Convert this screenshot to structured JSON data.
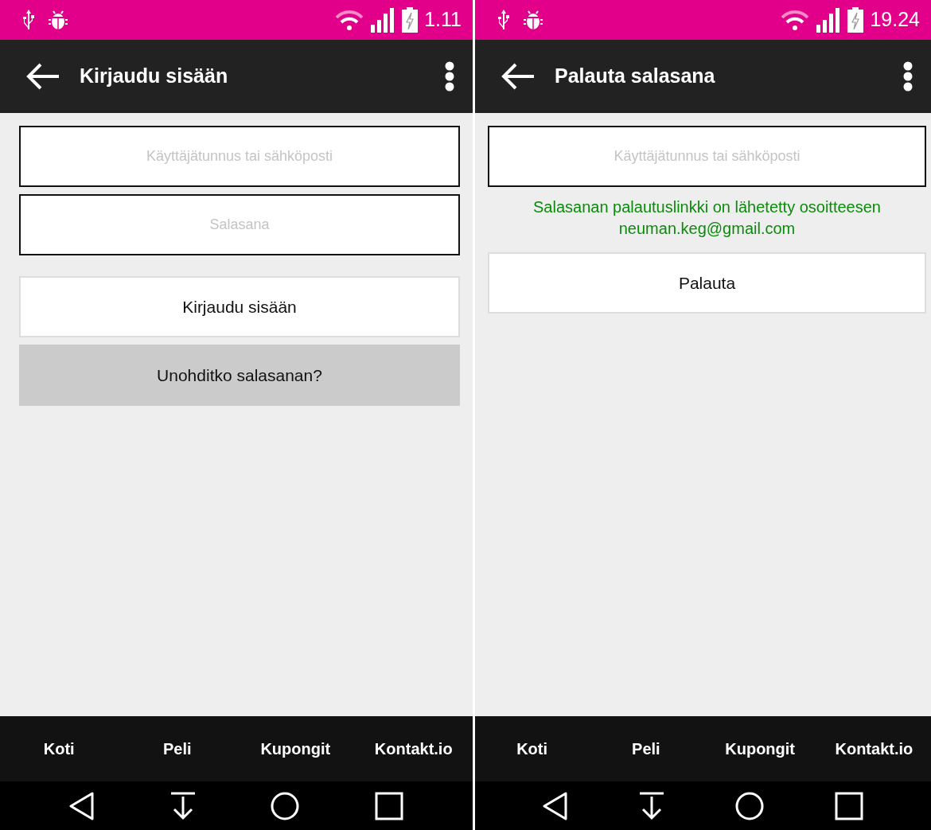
{
  "screens": [
    {
      "status_bar": {
        "time": "1.11"
      },
      "toolbar": {
        "title": "Kirjaudu sisään"
      },
      "fields": [
        {
          "placeholder": "Käyttäjätunnus tai sähköposti"
        },
        {
          "placeholder": "Salasana"
        }
      ],
      "buttons": [
        {
          "label": "Kirjaudu sisään",
          "kind": "primary"
        },
        {
          "label": "Unohditko salasanan?",
          "kind": "secondary"
        }
      ],
      "bottom_tabs": [
        "Koti",
        "Peli",
        "Kupongit",
        "Kontakt.io"
      ]
    },
    {
      "status_bar": {
        "time": "19.24"
      },
      "toolbar": {
        "title": "Palauta salasana"
      },
      "fields": [
        {
          "placeholder": "Käyttäjätunnus tai sähköposti"
        }
      ],
      "message": "Salasanan palautuslinkki on lähetetty osoitteesen neuman.keg@gmail.com",
      "buttons": [
        {
          "label": "Palauta",
          "kind": "primary"
        }
      ],
      "bottom_tabs": [
        "Koti",
        "Peli",
        "Kupongit",
        "Kontakt.io"
      ]
    }
  ]
}
